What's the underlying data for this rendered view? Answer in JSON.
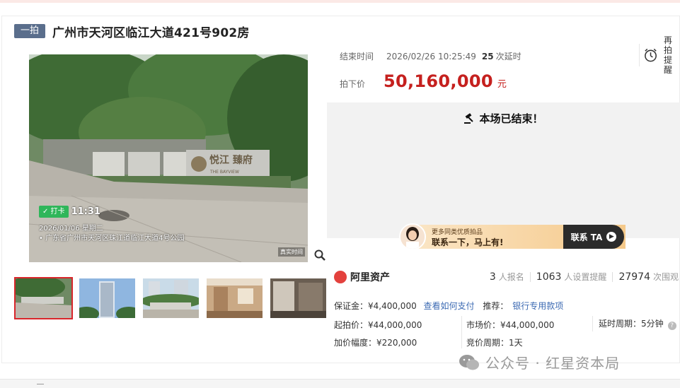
{
  "listing": {
    "badge": "一拍",
    "title": "广州市天河区临江大道421号902房"
  },
  "photo": {
    "checkin_tag": "✓ 打卡",
    "checkin_time": "11:31",
    "date": "2026/01/06 星期二",
    "location": "• 广东省广州市天河区珠江道临江大道4号公园",
    "watermark": "真实时间",
    "sign_text": "THE BAYVIEW"
  },
  "auction": {
    "end_label": "结束时间",
    "end_time": "2026/02/26 10:25:49",
    "delay_count": "25",
    "delay_unit": "次延时",
    "price_label": "拍下价",
    "price": "50,160,000",
    "price_unit": "元",
    "ended_text": "本场已结束！",
    "remind_line1": "再拍",
    "remind_line2": "提醒"
  },
  "promo": {
    "line1": "更多同类优质拍品",
    "line2": "联系一下，马上有!",
    "button": "联系 TA",
    "arrow": "▶"
  },
  "brand": {
    "name": "阿里资产",
    "signup_count": "3",
    "signup_label": "人报名",
    "reminder_count": "1063",
    "reminder_label": "人设置提醒",
    "watch_count": "27974",
    "watch_label": "次围观"
  },
  "details": {
    "deposit": "保证金：¥4,400,000",
    "deposit_link": "查看如何支付",
    "recommend_label": "推荐：",
    "recommend_link": "银行专用款项",
    "start_price": "起拍价：¥44,000,000",
    "market_price": "市场价：¥44,000,000",
    "delay_period": "延时周期：5分钟",
    "increment": "加价幅度：¥220,000",
    "bid_period": "竞价周期：1天",
    "help": "?"
  },
  "watermark_text": "公众号 · 红星资本局",
  "thumbnails": [
    "photo-1",
    "photo-2",
    "photo-3",
    "photo-4",
    "photo-5"
  ]
}
